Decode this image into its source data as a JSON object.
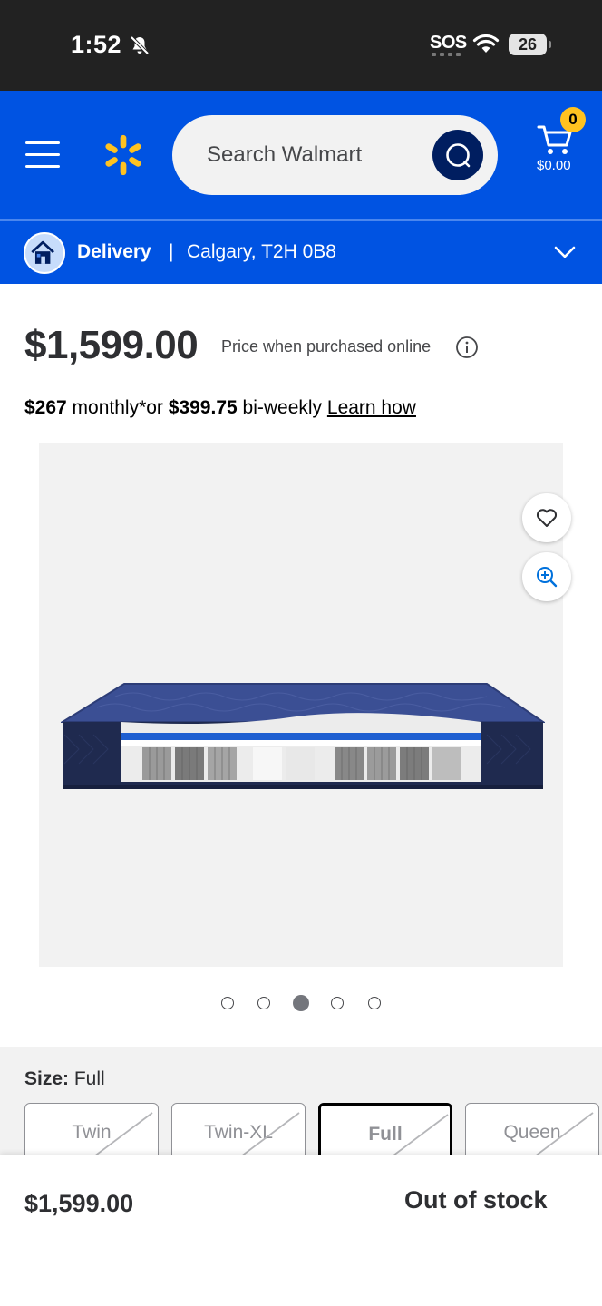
{
  "status_bar": {
    "time": "1:52",
    "sos": "SOS",
    "battery": "26"
  },
  "header": {
    "search_placeholder": "Search Walmart",
    "cart_count": "0",
    "cart_total": "$0.00",
    "brand_color": "#0053e2",
    "spark_color": "#ffc220"
  },
  "delivery": {
    "label": "Delivery",
    "separator": "|",
    "location": "Calgary, T2H 0B8"
  },
  "product": {
    "price": "$1,599.00",
    "price_note": "Price when purchased online",
    "financing": {
      "monthly_amount": "$267",
      "monthly_text": " monthly*or ",
      "biweekly_amount": "$399.75",
      "biweekly_text": " bi-weekly ",
      "learn_link": "Learn how"
    },
    "image_count": 5,
    "active_image_index": 2
  },
  "size": {
    "label": "Size:",
    "selected": "Full",
    "options": [
      {
        "label": "Twin",
        "available": false,
        "selected": false
      },
      {
        "label": "Twin-XL",
        "available": false,
        "selected": false
      },
      {
        "label": "Full",
        "available": false,
        "selected": true
      },
      {
        "label": "Queen",
        "available": false,
        "selected": false
      }
    ]
  },
  "bottom_bar": {
    "price": "$1,599.00",
    "stock_status": "Out of stock"
  }
}
